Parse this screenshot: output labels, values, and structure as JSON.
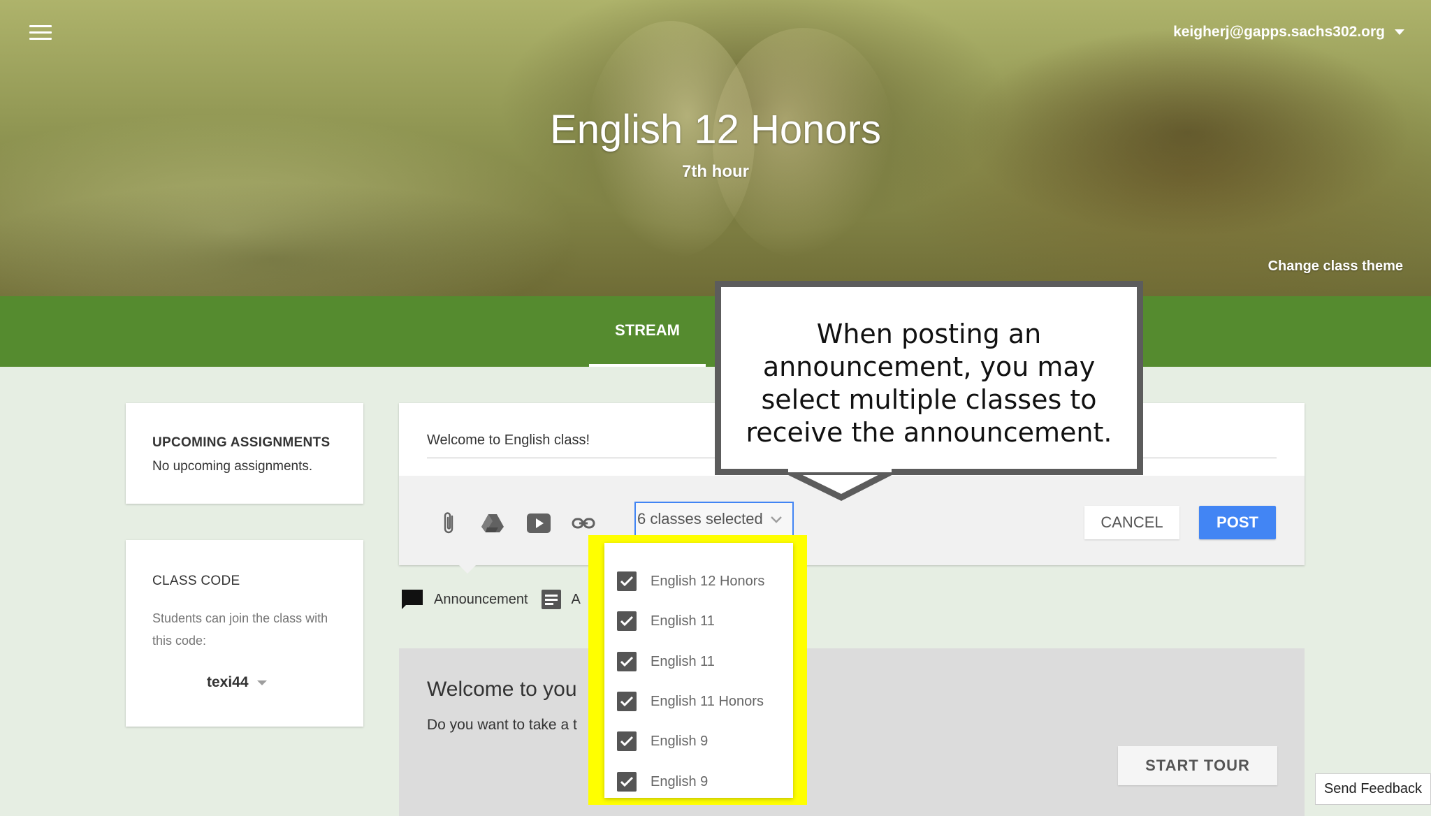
{
  "header": {
    "account_email": "keigherj@gapps.sachs302.org",
    "class_title": "English 12 Honors",
    "class_subtitle": "7th hour",
    "change_theme_label": "Change class theme"
  },
  "tabs": {
    "stream_label": "STREAM"
  },
  "sidebar": {
    "upcoming": {
      "title": "UPCOMING ASSIGNMENTS",
      "empty_text": "No upcoming assignments."
    },
    "class_code": {
      "title": "CLASS CODE",
      "description": "Students can join the class with this code:",
      "code": "texi44"
    }
  },
  "composer": {
    "text_value": "Welcome to English class!",
    "class_select_label": "6 classes selected",
    "cancel_label": "CANCEL",
    "post_label": "POST",
    "icons": [
      "attach-icon",
      "drive-icon",
      "youtube-icon",
      "link-icon"
    ]
  },
  "post_types": {
    "announcement_label": "Announcement",
    "assignment_label_partial": "A"
  },
  "welcome": {
    "title": "Welcome to you",
    "description": "Do you want to take a t",
    "start_tour_label": "START TOUR"
  },
  "class_dropdown": {
    "items": [
      {
        "label": "English 12 Honors",
        "checked": true
      },
      {
        "label": "English 11",
        "checked": true
      },
      {
        "label": "English 11",
        "checked": true
      },
      {
        "label": "English 11 Honors",
        "checked": true
      },
      {
        "label": "English 9",
        "checked": true
      },
      {
        "label": "English 9",
        "checked": true
      }
    ],
    "highlight_color": "#ffff00"
  },
  "callout": {
    "text": "When posting an announcement, you may select multiple classes to receive the announcement."
  },
  "feedback_label": "Send Feedback",
  "colors": {
    "tab_bar": "#558b2f",
    "post_button": "#4285f4",
    "page_bg": "#e6eee3"
  }
}
